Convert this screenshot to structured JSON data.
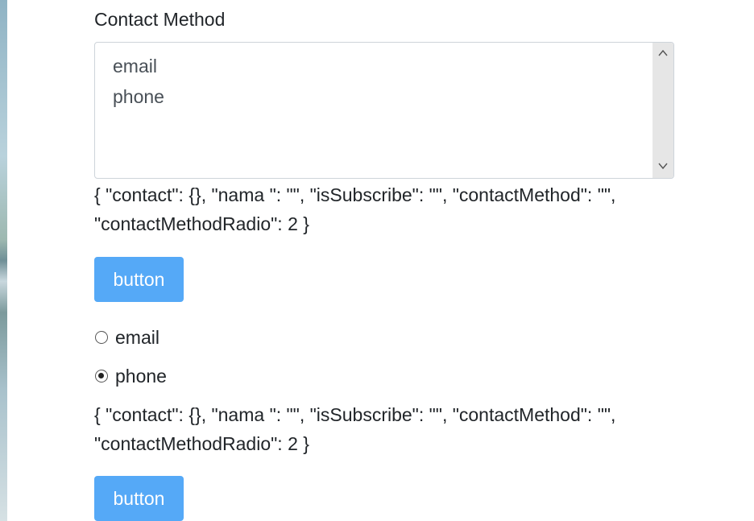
{
  "form": {
    "contact_method_label": "Contact Method",
    "listbox_options": [
      "email",
      "phone"
    ],
    "json_output_1": "{ \"contact\": {}, \"nama \": \"\", \"isSubscribe\": \"\", \"contactMethod\": \"\", \"contactMethodRadio\": 2 }",
    "button_1_label": "button",
    "radio_options": [
      {
        "label": "email",
        "checked": false
      },
      {
        "label": "phone",
        "checked": true
      }
    ],
    "json_output_2": "{ \"contact\": {}, \"nama \": \"\", \"isSubscribe\": \"\", \"contactMethod\": \"\", \"contactMethodRadio\": 2 }",
    "button_2_label": "button"
  },
  "colors": {
    "button_bg": "#55a9f7",
    "scrollbar_bg": "#e6e6e6",
    "border": "#ced4da"
  },
  "icons": {
    "scroll_up": "chevron-up-icon",
    "scroll_down": "chevron-down-icon"
  }
}
